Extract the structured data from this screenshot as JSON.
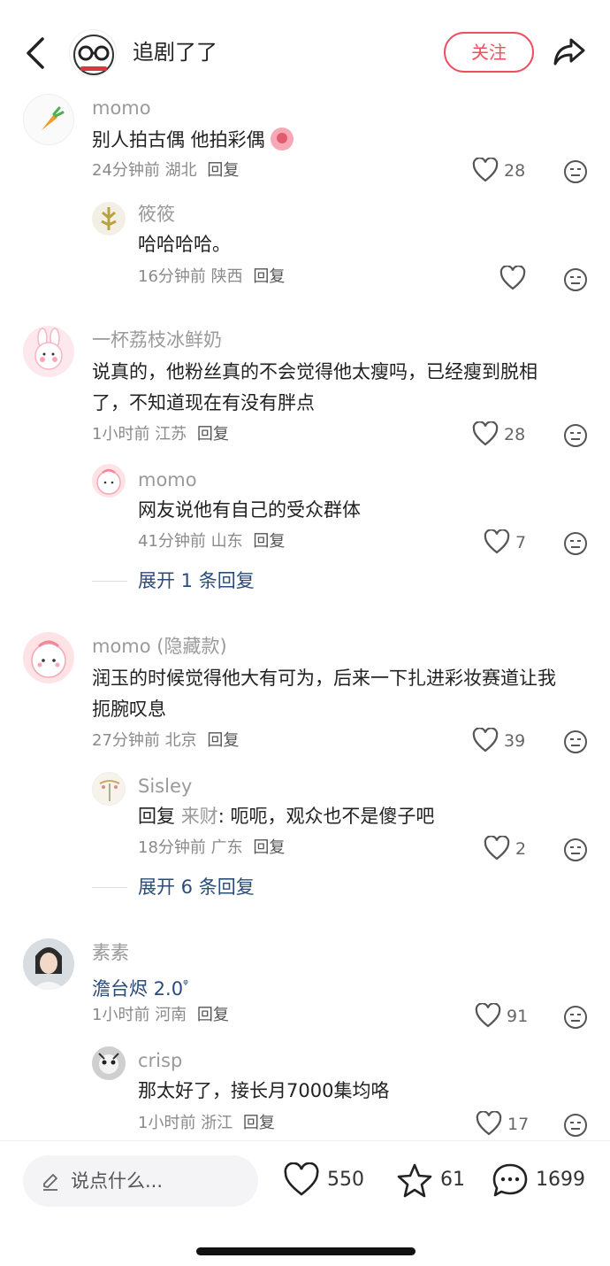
{
  "header": {
    "channel_name": "追剧了了",
    "follow_label": "关注"
  },
  "comments": [
    {
      "username": "momo",
      "text": "别人拍古偶 他拍彩偶",
      "time": "24分钟前",
      "location": "湖北",
      "reply_label": "回复",
      "likes": "28",
      "replies": [
        {
          "username": "筱筱",
          "text": "哈哈哈哈。",
          "time": "16分钟前",
          "location": "陕西",
          "reply_label": "回复",
          "likes": ""
        }
      ]
    },
    {
      "username": "一杯荔枝冰鲜奶",
      "text_line1": "说真的，他粉丝真的不会觉得他太瘦吗，已经瘦到脱相",
      "text_line2": "了，不知道现在有没有胖点",
      "time": "1小时前",
      "location": "江苏",
      "reply_label": "回复",
      "likes": "28",
      "replies": [
        {
          "username": "momo",
          "text": "网友说他有自己的受众群体",
          "time": "41分钟前",
          "location": "山东",
          "reply_label": "回复",
          "likes": "7"
        }
      ],
      "expand_label": "展开 1 条回复"
    },
    {
      "username": "momo",
      "username_suffix": "(隐藏款)",
      "text_line1": "润玉的时候觉得他大有可为，后来一下扎进彩妆赛道让我",
      "text_line2": "扼腕叹息",
      "time": "27分钟前",
      "location": "北京",
      "reply_label": "回复",
      "likes": "39",
      "replies": [
        {
          "username": "Sisley",
          "reply_prefix": "回复",
          "reply_to": "来财",
          "text": ": 呃呃，观众也不是傻子吧",
          "time": "18分钟前",
          "location": "广东",
          "reply_label": "回复",
          "likes": "2"
        }
      ],
      "expand_label": "展开 6 条回复"
    },
    {
      "username": "素素",
      "text": "澹台烬 2.0",
      "time": "1小时前",
      "location": "河南",
      "reply_label": "回复",
      "likes": "91",
      "replies": [
        {
          "username": "crisp",
          "text": "那太好了，接长月7000集均咯",
          "time": "1小时前",
          "location": "浙江",
          "reply_label": "回复",
          "likes": "17"
        }
      ]
    }
  ],
  "bottom_bar": {
    "input_placeholder": "说点什么...",
    "likes": "550",
    "favorites": "61",
    "comments": "1699"
  },
  "colors": {
    "accent": "#f04e5e",
    "link": "#2a4c7a",
    "muted": "#9a9a9a"
  },
  "icons": [
    "back-arrow-icon",
    "share-icon",
    "heart-icon",
    "dislike-face-icon",
    "pencil-icon",
    "star-icon",
    "comment-bubble-icon",
    "search-link-icon"
  ]
}
